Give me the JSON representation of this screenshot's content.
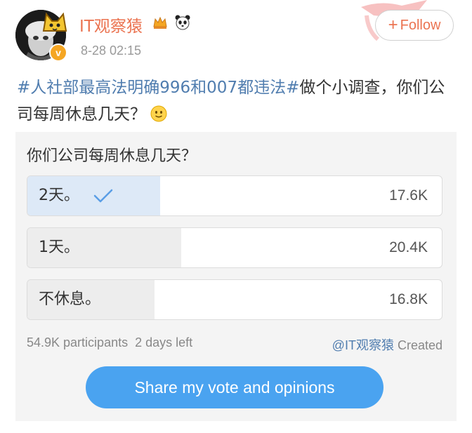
{
  "header": {
    "username": "IT观察猿",
    "timestamp": "8-28 02:15",
    "follow_plus": "+",
    "follow_label": "Follow"
  },
  "post": {
    "hashtag": "#人社部最高法明确996和007都违法#",
    "text": "做个小调查，你们公司每周休息几天？"
  },
  "poll": {
    "question": "你们公司每周休息几天？",
    "options": [
      {
        "label": "2天。",
        "count": "17.6K",
        "votes": 17600,
        "selected": true
      },
      {
        "label": "1天。",
        "count": "20.4K",
        "votes": 20400,
        "selected": false
      },
      {
        "label": "不休息。",
        "count": "16.8K",
        "votes": 16800,
        "selected": false
      }
    ],
    "participants": "54.9K participants",
    "time_left": "2 days left",
    "creator": "@IT观察猿",
    "created_label": " Created",
    "share_label": "Share my vote and opinions"
  },
  "colors": {
    "username": "#eb7350",
    "hashtag": "#507daf",
    "share_button": "#4aa3f0",
    "selected_fill": "#dde9f7"
  },
  "icons": [
    "avatar",
    "verified-badge",
    "crown-icon",
    "panda-icon",
    "smile-emoji-icon",
    "check-icon"
  ]
}
